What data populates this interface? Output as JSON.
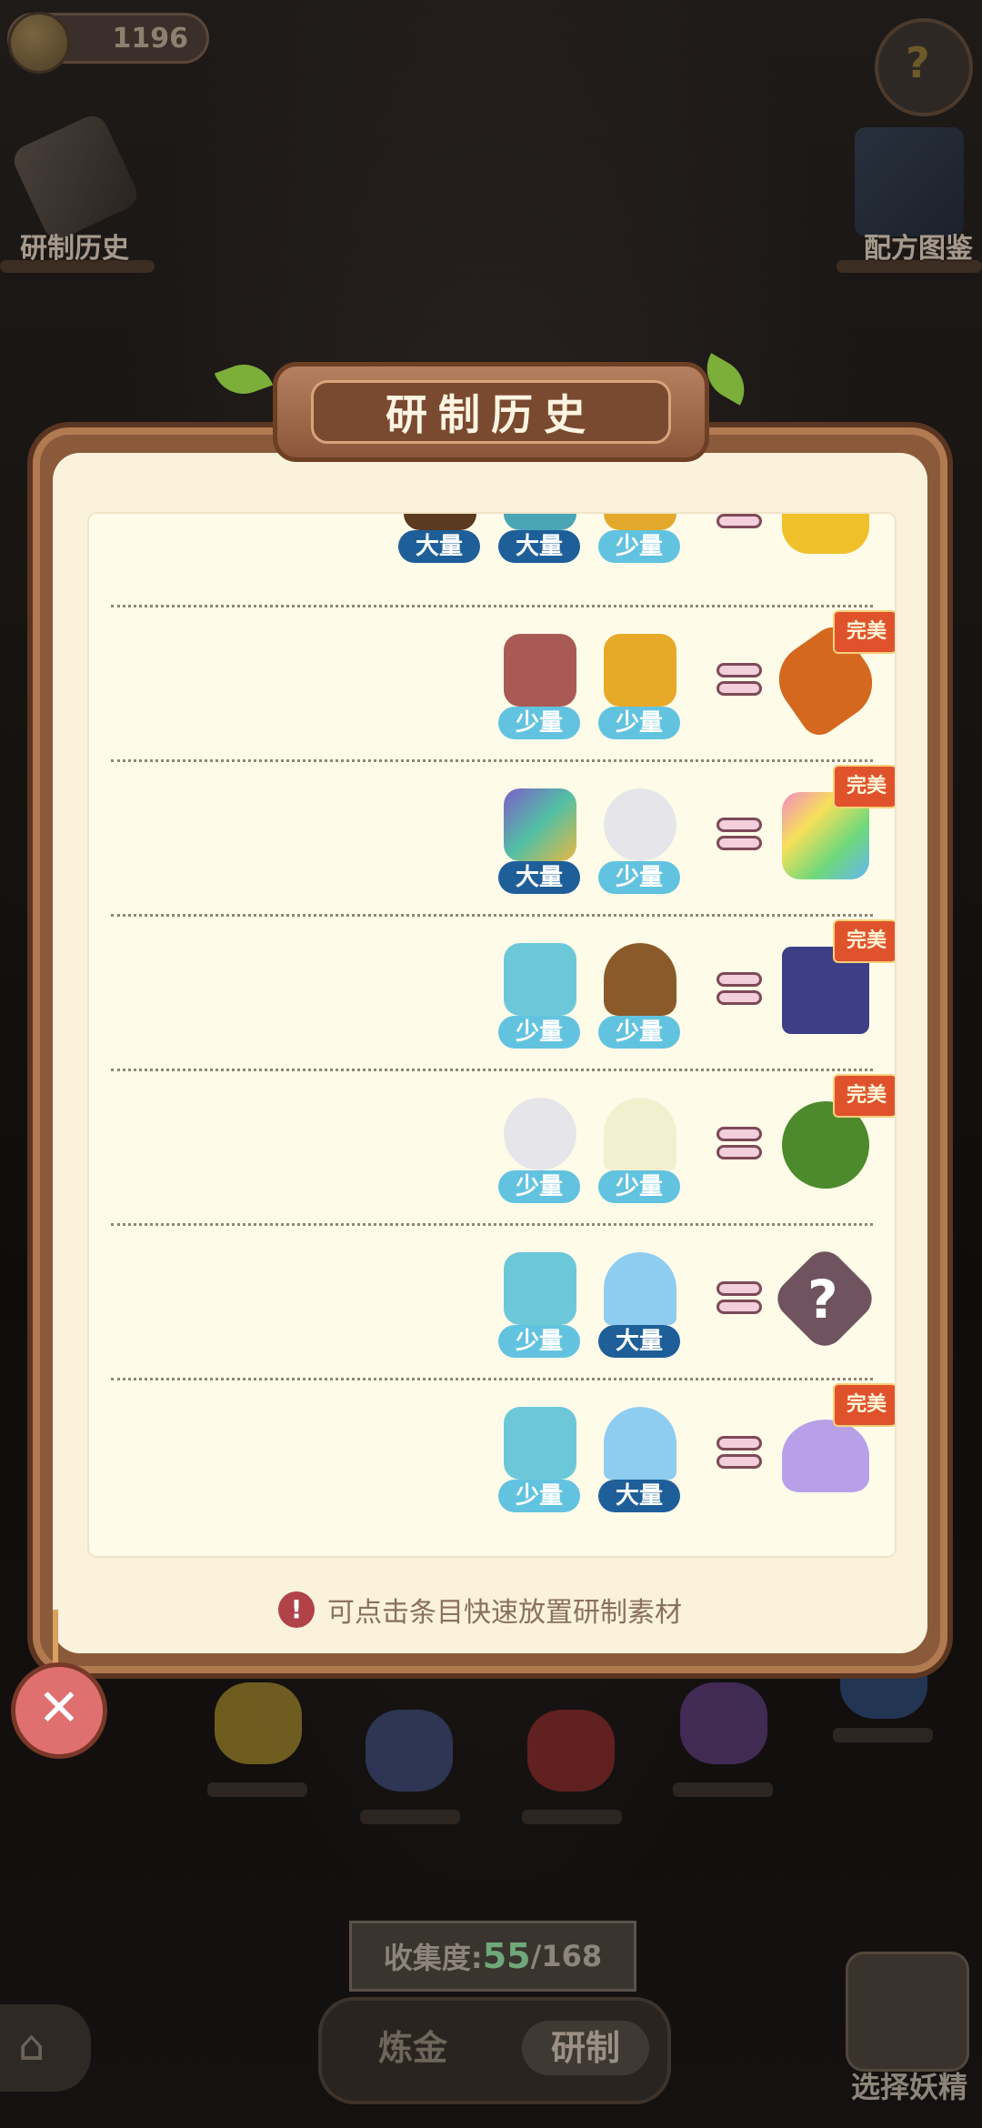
{
  "hud": {
    "coins": "1196",
    "history_label": "研制历史",
    "recipe_book_label": "配方图鉴",
    "help_icon": "help-seedling-icon"
  },
  "dialog": {
    "title": "研制历史",
    "tip": "可点击条目快速放置研制素材",
    "close_icon": "close-x-icon",
    "rows": [
      {
        "ingredients": [
          {
            "name": "partial-brown-item",
            "qty": "大量"
          },
          {
            "name": "partial-blue-item",
            "qty": "大量"
          },
          {
            "name": "partial-golden-item",
            "qty": "少量"
          }
        ],
        "result": "partial-lemon-item",
        "perfect": ""
      },
      {
        "ingredients": [
          {
            "name": "spiky-red-crystal",
            "qty": "少量"
          },
          {
            "name": "golden-leaves",
            "qty": "少量"
          }
        ],
        "result": "bread-loaf",
        "perfect": "完美"
      },
      {
        "ingredients": [
          {
            "name": "rainbow-wing",
            "qty": "大量"
          },
          {
            "name": "white-cloud-puff",
            "qty": "少量"
          }
        ],
        "result": "rainbow-crystal",
        "perfect": "完美"
      },
      {
        "ingredients": [
          {
            "name": "blue-mushrooms",
            "qty": "少量"
          },
          {
            "name": "dirt-pile",
            "qty": "少量"
          }
        ],
        "result": "blue-chest",
        "perfect": "完美"
      },
      {
        "ingredients": [
          {
            "name": "white-cloud-puff",
            "qty": "少量"
          },
          {
            "name": "white-lily",
            "qty": "少量"
          }
        ],
        "result": "green-turtle",
        "perfect": "完美"
      },
      {
        "ingredients": [
          {
            "name": "blue-mushrooms",
            "qty": "少量"
          },
          {
            "name": "blue-salt-mound",
            "qty": "大量"
          }
        ],
        "result": "unknown-question",
        "perfect": ""
      },
      {
        "ingredients": [
          {
            "name": "blue-mushrooms",
            "qty": "少量"
          },
          {
            "name": "blue-salt-mound",
            "qty": "大量"
          }
        ],
        "result": "purple-powder",
        "perfect": "完美"
      }
    ]
  },
  "bottom": {
    "collection_label": "收集度:",
    "collection_value": "55",
    "collection_total": "/168",
    "tab_alchemy": "炼金",
    "tab_research": "研制",
    "choose_spirit": "选择妖精"
  },
  "colors": {
    "small_pill": "#62c3e0",
    "large_pill": "#1e5f9a",
    "perfect_badge": "#e0522c"
  }
}
